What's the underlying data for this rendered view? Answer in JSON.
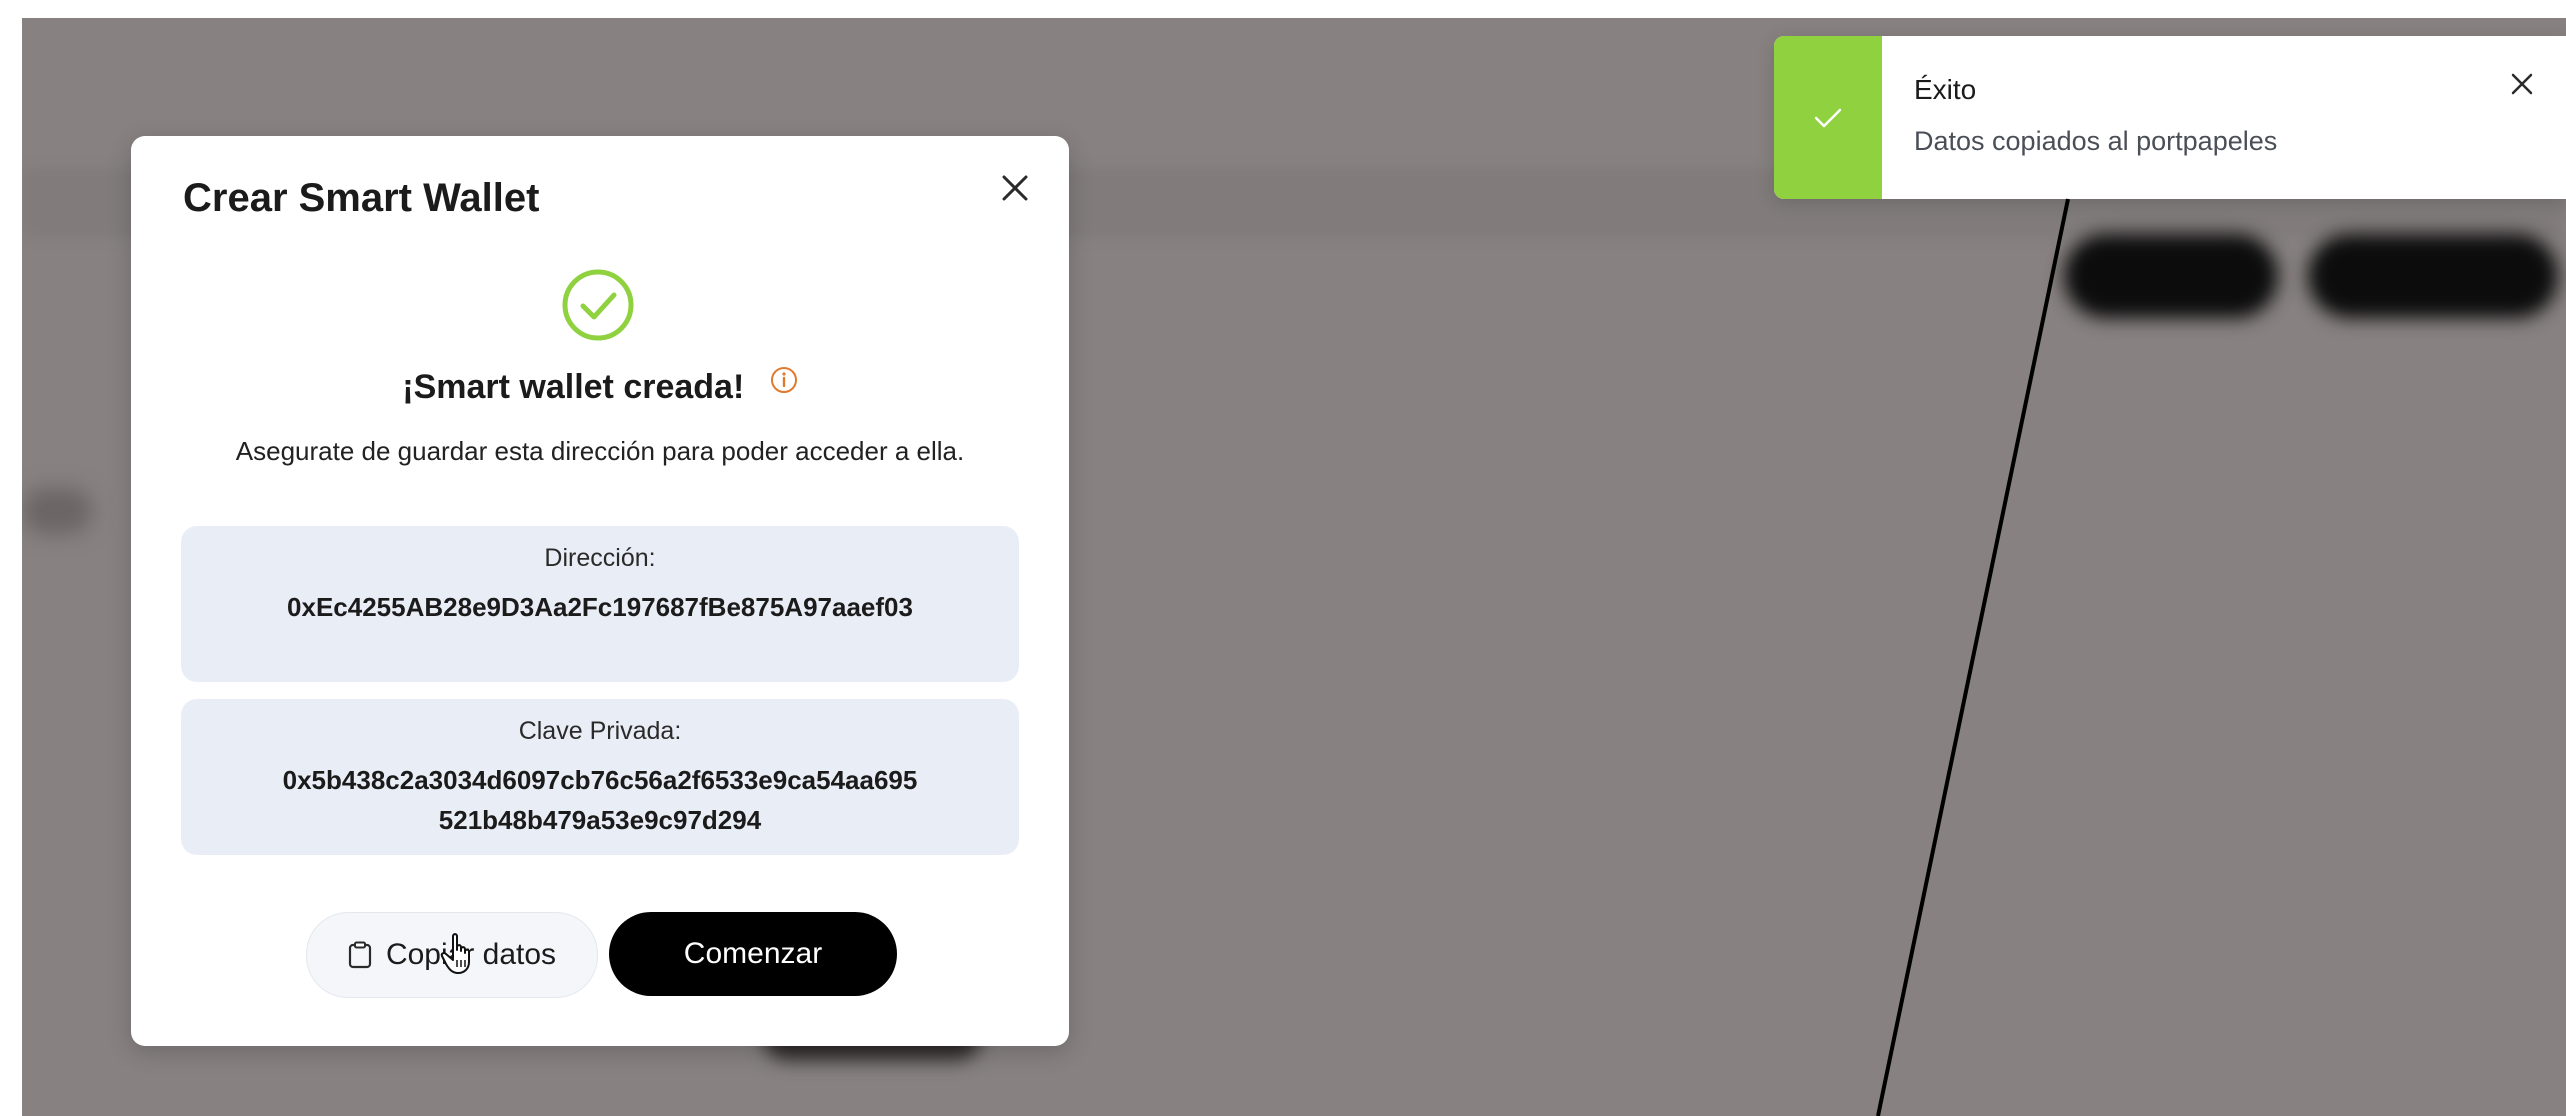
{
  "modal": {
    "title": "Crear Smart Wallet",
    "close_icon": "close-icon",
    "success_heading": "¡Smart wallet creada!",
    "subtitle": "Asegurate de guardar esta dirección para poder acceder a ella.",
    "address": {
      "label": "Dirección:",
      "value": "0xEc4255AB28e9D3Aa2Fc197687fBe875A97aaef03"
    },
    "private_key": {
      "label": "Clave Privada:",
      "value": "0x5b438c2a3034d6097cb76c56a2f6533e9ca54aa695521b48b479a53e9c97d294"
    },
    "copy_button_label": "Copiar datos",
    "start_button_label": "Comenzar"
  },
  "toast": {
    "title": "Éxito",
    "message": "Datos copiados al portpapeles",
    "close_icon": "close-icon"
  },
  "colors": {
    "overlay": "#878181",
    "success_green": "#8fd13f",
    "info_orange": "#e07a2e",
    "card_bg": "#e9eef6",
    "primary_button": "#000000"
  }
}
